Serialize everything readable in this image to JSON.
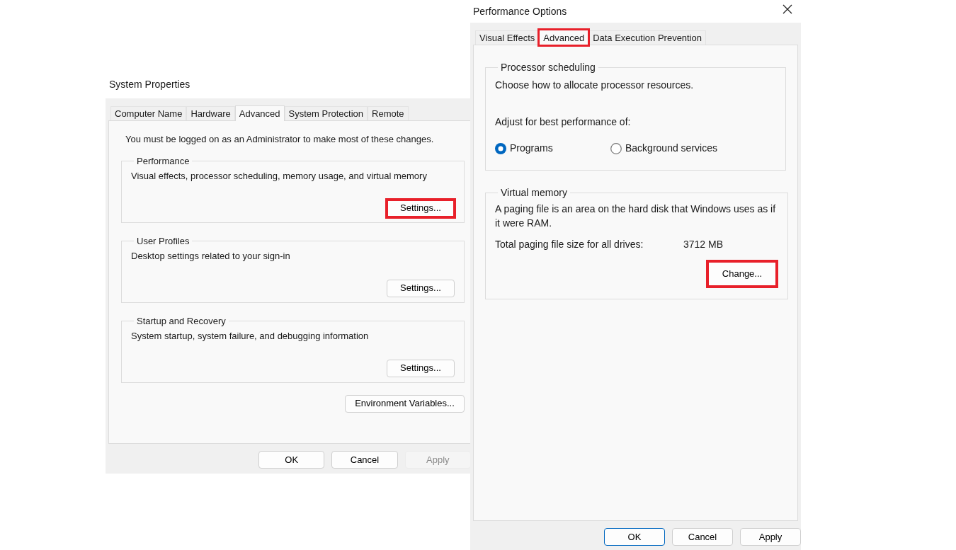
{
  "system_properties": {
    "title": "System Properties",
    "tabs": [
      {
        "label": "Computer Name",
        "selected": false,
        "highlighted": false
      },
      {
        "label": "Hardware",
        "selected": false,
        "highlighted": false
      },
      {
        "label": "Advanced",
        "selected": true,
        "highlighted": false
      },
      {
        "label": "System Protection",
        "selected": false,
        "highlighted": false
      },
      {
        "label": "Remote",
        "selected": false,
        "highlighted": false
      }
    ],
    "notice": "You must be logged on as an Administrator to make most of these changes.",
    "groups": [
      {
        "title": "Performance",
        "description": "Visual effects, processor scheduling, memory usage, and virtual memory",
        "button": {
          "label": "Settings...",
          "highlighted": true
        }
      },
      {
        "title": "User Profiles",
        "description": "Desktop settings related to your sign-in",
        "button": {
          "label": "Settings...",
          "highlighted": false
        }
      },
      {
        "title": "Startup and Recovery",
        "description": "System startup, system failure, and debugging information",
        "button": {
          "label": "Settings...",
          "highlighted": false
        }
      }
    ],
    "environment_button": {
      "label": "Environment Variables..."
    },
    "footer_buttons": [
      {
        "label": "OK",
        "disabled": false,
        "default": false
      },
      {
        "label": "Cancel",
        "disabled": false,
        "default": false
      },
      {
        "label": "Apply",
        "disabled": true,
        "default": false
      }
    ]
  },
  "performance_options": {
    "title": "Performance Options",
    "tabs": [
      {
        "label": "Visual Effects",
        "selected": false,
        "highlighted": false
      },
      {
        "label": "Advanced",
        "selected": true,
        "highlighted": true
      },
      {
        "label": "Data Execution Prevention",
        "selected": false,
        "highlighted": false
      }
    ],
    "processor_group": {
      "title": "Processor scheduling",
      "description": "Choose how to allocate processor resources.",
      "prompt": "Adjust for best performance of:",
      "options": [
        {
          "label": "Programs",
          "selected": true
        },
        {
          "label": "Background services",
          "selected": false
        }
      ]
    },
    "memory_group": {
      "title": "Virtual memory",
      "description": "A paging file is an area on the hard disk that Windows uses as if it were RAM.",
      "total_label": "Total paging file size for all drives:",
      "total_value": "3712 MB",
      "button": {
        "label": "Change...",
        "highlighted": true
      }
    },
    "footer_buttons": [
      {
        "label": "OK",
        "disabled": false,
        "default": true
      },
      {
        "label": "Cancel",
        "disabled": false,
        "default": false
      },
      {
        "label": "Apply",
        "disabled": false,
        "default": false
      }
    ]
  }
}
